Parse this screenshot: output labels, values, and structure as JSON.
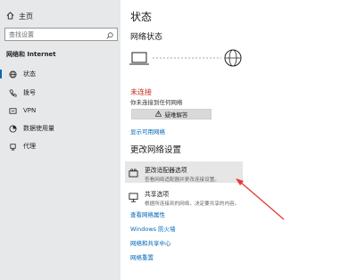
{
  "sidebar": {
    "home_label": "主页",
    "search_placeholder": "查找设置",
    "section_title": "网络和 Internet",
    "items": [
      {
        "label": "状态",
        "icon": "globe-icon"
      },
      {
        "label": "拨号",
        "icon": "phone-icon"
      },
      {
        "label": "VPN",
        "icon": "vpn-icon"
      },
      {
        "label": "数据使用量",
        "icon": "data-usage-icon"
      },
      {
        "label": "代理",
        "icon": "proxy-icon"
      }
    ]
  },
  "main": {
    "page_title": "状态",
    "network_status_heading": "网络状态",
    "status_text": "未连接",
    "status_sub": "你未连接到任何网络",
    "troubleshoot_label": "疑难解答",
    "show_networks_link": "显示可用网络",
    "change_settings_heading": "更改网络设置",
    "options": [
      {
        "title": "更改适配器选项",
        "desc": "查看网络适配器并更改连接设置。"
      },
      {
        "title": "共享选项",
        "desc": "根据所连接到的网络，决定要共享的内容。"
      }
    ],
    "links": [
      "查看网络属性",
      "Windows 防火墙",
      "网络和共享中心",
      "网络重置"
    ]
  },
  "colors": {
    "accent": "#0067b8",
    "error": "#c42b1c",
    "sidebar_bg": "#e6e8ea",
    "annotation": "#e53935"
  }
}
